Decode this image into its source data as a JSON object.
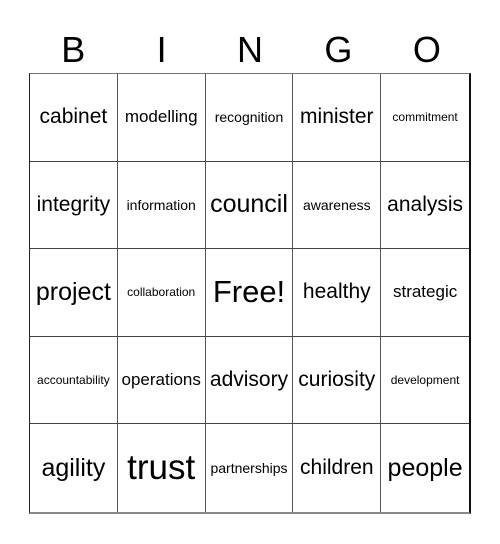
{
  "header": [
    "B",
    "I",
    "N",
    "G",
    "O"
  ],
  "cells": [
    {
      "text": "cabinet",
      "size": "large"
    },
    {
      "text": "modelling",
      "size": "medium"
    },
    {
      "text": "recognition",
      "size": "small"
    },
    {
      "text": "minister",
      "size": "large"
    },
    {
      "text": "commitment",
      "size": "xsmall"
    },
    {
      "text": "integrity",
      "size": "large"
    },
    {
      "text": "information",
      "size": "small"
    },
    {
      "text": "council",
      "size": "xlarge"
    },
    {
      "text": "awareness",
      "size": "small"
    },
    {
      "text": "analysis",
      "size": "large"
    },
    {
      "text": "project",
      "size": "xlarge"
    },
    {
      "text": "collaboration",
      "size": "xsmall"
    },
    {
      "text": "Free!",
      "size": "free"
    },
    {
      "text": "healthy",
      "size": "large"
    },
    {
      "text": "strategic",
      "size": "medium"
    },
    {
      "text": "accountability",
      "size": "xsmall"
    },
    {
      "text": "operations",
      "size": "medium"
    },
    {
      "text": "advisory",
      "size": "large"
    },
    {
      "text": "curiosity",
      "size": "large"
    },
    {
      "text": "development",
      "size": "xsmall"
    },
    {
      "text": "agility",
      "size": "xlarge"
    },
    {
      "text": "trust",
      "size": "huge"
    },
    {
      "text": "partnerships",
      "size": "small"
    },
    {
      "text": "children",
      "size": "large"
    },
    {
      "text": "people",
      "size": "xlarge"
    }
  ]
}
